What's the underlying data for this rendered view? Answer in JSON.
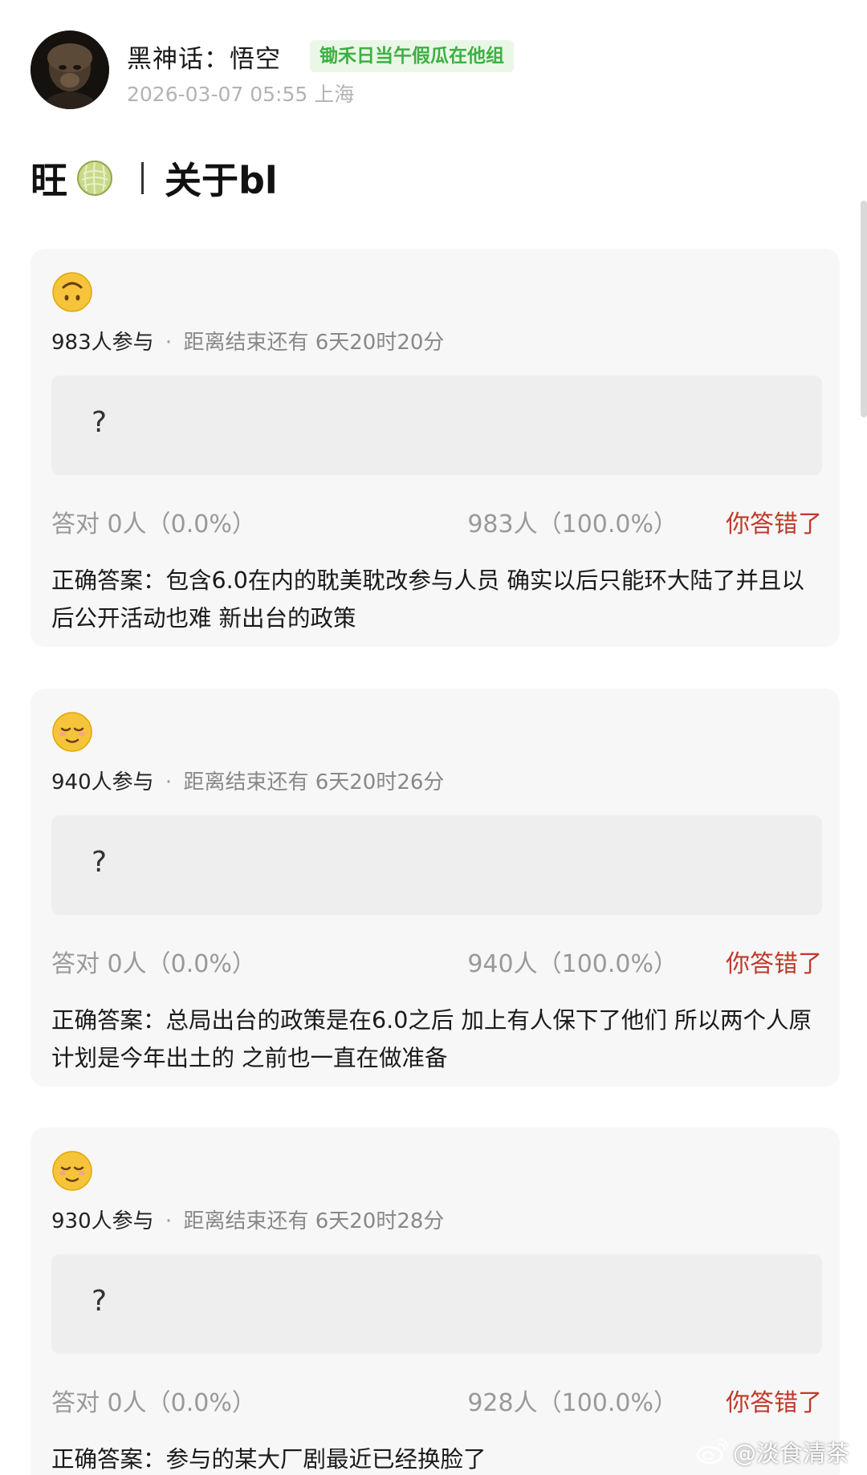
{
  "post": {
    "username": "黑神话：悟空",
    "group_badge": "锄禾日当午假瓜在他组",
    "meta": "2026-03-07 05:55 上海",
    "title_left": "旺",
    "title_right": "关于bl"
  },
  "icons": {
    "title": "melon-icon",
    "card1": "upside-down-face-icon",
    "card2": "relieved-face-icon",
    "card3": "relieved-face-icon"
  },
  "polls": [
    {
      "participants": "983人参与",
      "separator": "·",
      "remaining": "距离结束还有 6天20时20分",
      "question": "?",
      "correct_stat": "答对  0人（0.0%）",
      "wrong_stat": "983人（100.0%）",
      "wrong_label": "你答错了",
      "answer": "正确答案：包含6.0在内的耽美耽改参与人员 确实以后只能环大陆了并且以后公开活动也难 新出台的政策"
    },
    {
      "participants": "940人参与",
      "separator": "·",
      "remaining": "距离结束还有 6天20时26分",
      "question": "?",
      "correct_stat": "答对  0人（0.0%）",
      "wrong_stat": "940人（100.0%）",
      "wrong_label": "你答错了",
      "answer": "正确答案：总局出台的政策是在6.0之后 加上有人保下了他们 所以两个人原计划是今年出土的 之前也一直在做准备"
    },
    {
      "participants": "930人参与",
      "separator": "·",
      "remaining": "距离结束还有 6天20时28分",
      "question": "?",
      "correct_stat": "答对  0人（0.0%）",
      "wrong_stat": "928人（100.0%）",
      "wrong_label": "你答错了",
      "answer": "正确答案：参与的某大厂剧最近已经换脸了"
    }
  ],
  "watermark": "@淡食清茶",
  "colors": {
    "accent_green": "#3cb043",
    "wrong_red": "#c0392b",
    "card_bg": "#f7f7f7"
  }
}
